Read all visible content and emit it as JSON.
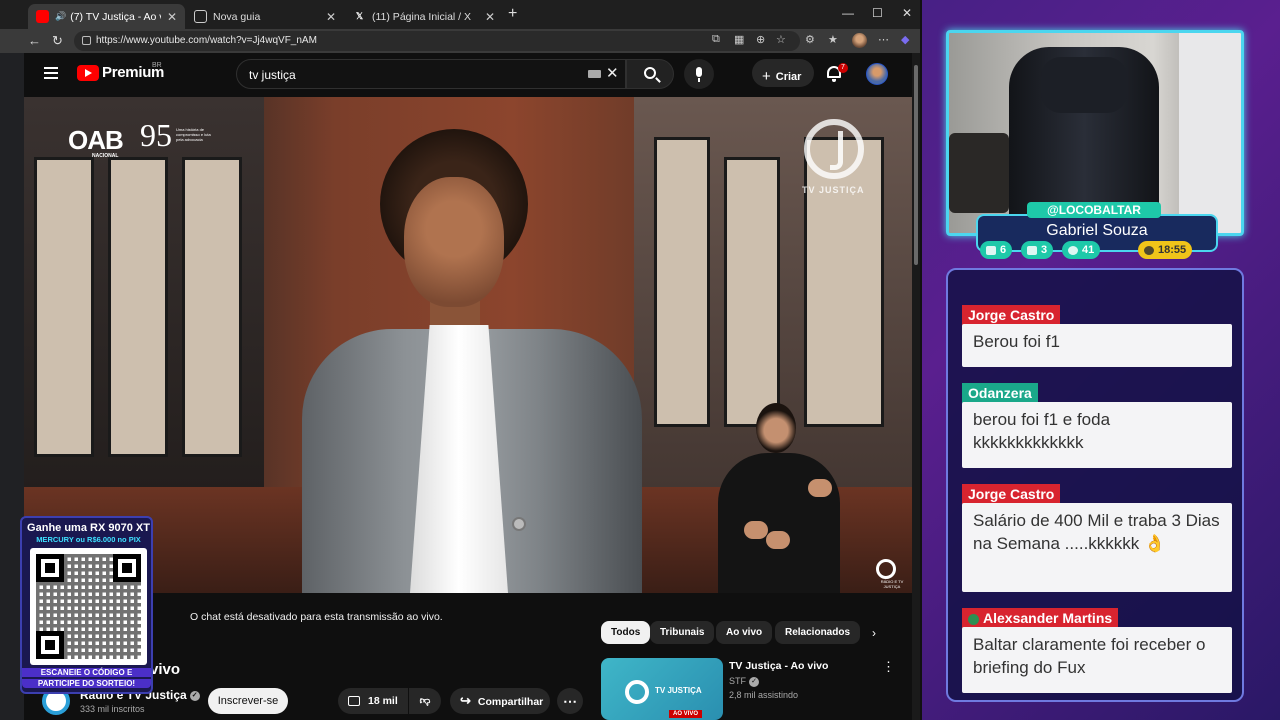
{
  "browser": {
    "tabs": [
      {
        "label": "(7) TV Justiça - Ao vivo - You",
        "active": true,
        "favicon": "youtube-icon"
      },
      {
        "label": "Nova guia",
        "active": false,
        "favicon": "page-icon"
      },
      {
        "label": "(11) Página Inicial / X",
        "active": false,
        "favicon": "x-icon"
      }
    ],
    "url": "https://www.youtube.com/watch?v=Jj4wqVF_nAM"
  },
  "youtube": {
    "brand": "Premium",
    "region": "BR",
    "search_value": "tv justiça",
    "create_label": "Criar",
    "notifications": "7",
    "chat_disabled": "O chat está desativado para esta transmissão ao vivo.",
    "video_title_partial": "vivo",
    "channel_name": "Rádio e TV Justiça",
    "channel_subs": "333 mil inscritos",
    "subscribe_label": "Inscrever-se",
    "likes": "18 mil",
    "share_label": "Compartilhar",
    "overlay": {
      "oab": "OAB",
      "oab_sub": "NACIONAL",
      "oab_years": "95",
      "oab_note": "Uma história de compromisso e luta pela advocacia",
      "tv_logo_text": "TV JUSTIÇA",
      "radio_text": "RÁDIO E TV JUSTIÇA"
    },
    "related_tabs": [
      "Todos",
      "Tribunais",
      "Ao vivo",
      "Relacionados"
    ],
    "related": {
      "title": "TV Justiça - Ao vivo",
      "channel": "STF",
      "views": "2,8 mil assistindo",
      "thumb_text": "TV JUSTIÇA",
      "live_badge": "AO VIVO"
    }
  },
  "giveaway": {
    "title": "Ganhe uma RX 9070 XT",
    "subtitle": "MERCURY ou R$6.000 no PIX",
    "cta1": "ESCANEIE O CÓDIGO E",
    "cta2": "PARTICIPE DO SORTEIO!"
  },
  "stream": {
    "handle": "@LOCOBALTAR",
    "name": "Gabriel Souza",
    "stats": [
      {
        "icon": "chat-icon",
        "value": "6",
        "color": "#1ec9a9"
      },
      {
        "icon": "youtube-icon",
        "value": "3",
        "color": "#1ec9a9"
      },
      {
        "icon": "viewers-icon",
        "value": "41",
        "color": "#1ec9a9"
      },
      {
        "icon": "clock-icon",
        "value": "18:55",
        "color": "#f0c419"
      }
    ],
    "chat": [
      {
        "user": "Jorge Castro",
        "color": "#d8242f",
        "text": "Berou foi f1"
      },
      {
        "user": "Odanzera",
        "color": "#1aa88a",
        "text": "berou foi f1 e foda kkkkkkkkkkkkk"
      },
      {
        "user": "Jorge Castro",
        "color": "#d8242f",
        "text": "Salário de 400 Mil e traba 3 Dias na Semana .....kkkkkk 👌"
      },
      {
        "user": "Alexsander Martins",
        "color": "#d8242f",
        "text": "Baltar claramente foi receber o briefing do Fux"
      }
    ]
  },
  "colors": {
    "accent": "#4bd6ef",
    "youtube_red": "#ff0000",
    "panel_border": "#6f7ae0"
  }
}
